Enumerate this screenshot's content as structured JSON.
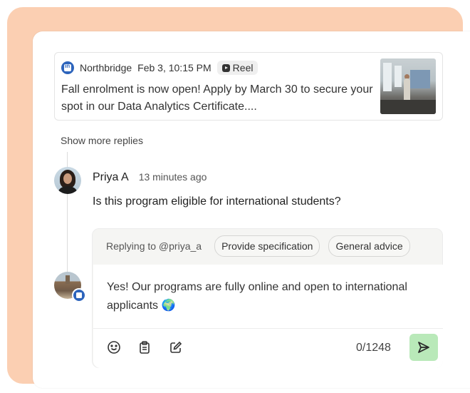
{
  "post": {
    "platform_icon": "linkedin-icon",
    "author": "Northbridge",
    "date": "Feb 3, 10:15 PM",
    "badge": "Reel",
    "text": "Fall enrolment is now open! Apply by March 30 to secure your spot in our Data Analytics Certificate...."
  },
  "thread": {
    "show_more": "Show more replies"
  },
  "comment": {
    "name": "Priya A",
    "time": "13 minutes ago",
    "text": "Is this program eligible for international students?"
  },
  "reply": {
    "replying_to": "Replying to @priya_a",
    "chips": [
      "Provide specification",
      "General advice"
    ],
    "draft": "Yes! Our programs are fully online and open to international applicants 🌍",
    "counter": "0/1248",
    "tools": [
      "emoji-icon",
      "clipboard-icon",
      "edit-icon"
    ],
    "send_color": "#b9e9b9"
  },
  "colors": {
    "backdrop": "#fbcfb2",
    "linkedin": "#2d64bc"
  }
}
